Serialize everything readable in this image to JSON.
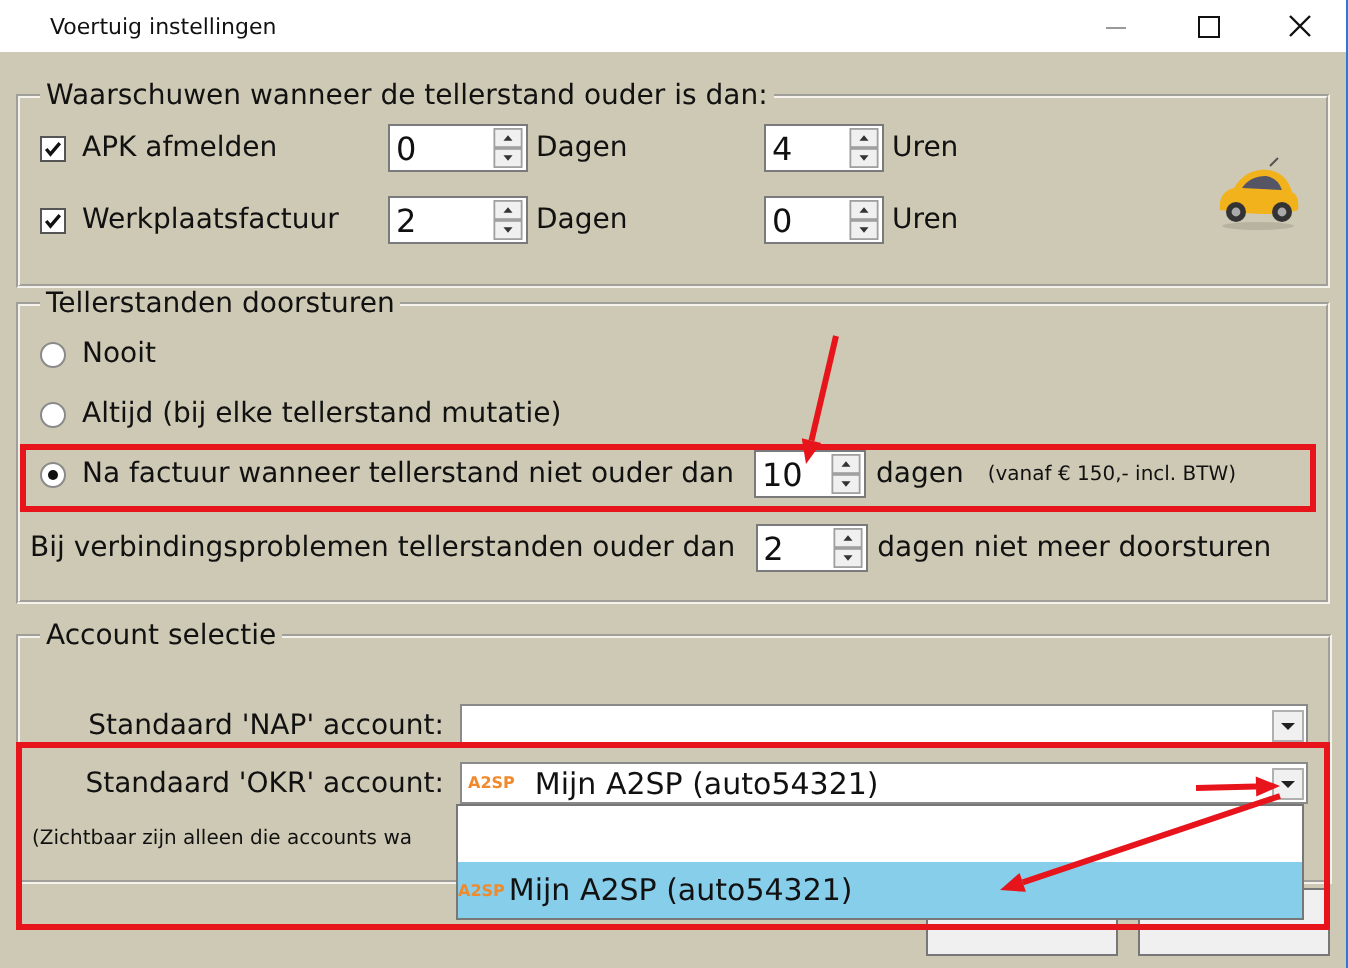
{
  "window": {
    "title": "Voertuig instellingen"
  },
  "warning_group": {
    "title": "Waarschuwen wanneer de tellerstand ouder is dan:",
    "rows": [
      {
        "label": "APK afmelden",
        "checked": true,
        "days": "0",
        "days_unit": "Dagen",
        "hours": "4",
        "hours_unit": "Uren"
      },
      {
        "label": "Werkplaatsfactuur",
        "checked": true,
        "days": "2",
        "days_unit": "Dagen",
        "hours": "0",
        "hours_unit": "Uren"
      }
    ]
  },
  "forward_group": {
    "title": "Tellerstanden doorsturen",
    "options": [
      {
        "label": "Nooit",
        "selected": false
      },
      {
        "label": "Altijd (bij elke tellerstand mutatie)",
        "selected": false
      },
      {
        "label": "Na factuur wanneer tellerstand niet ouder dan",
        "selected": true,
        "value": "10",
        "unit": "dagen",
        "note": "(vanaf € 150,- incl. BTW)"
      }
    ],
    "limit": {
      "label": "Bij verbindingsproblemen tellerstanden ouder dan",
      "value": "2",
      "unit": "dagen niet meer doorsturen"
    }
  },
  "account_group": {
    "title": "Account selectie",
    "fields": [
      {
        "label": "Standaard 'NAP' account:"
      },
      {
        "label": "Standaard 'OKR' account:",
        "logo": "A2SP",
        "value": "Mijn A2SP (auto54321)"
      }
    ],
    "note": "(Zichtbaar zijn alleen die accounts wa",
    "dropdown": {
      "items": [
        {
          "selected": false
        },
        {
          "logo": "A2SP",
          "label": "Mijn A2SP (auto54321)",
          "selected": true
        }
      ]
    }
  },
  "annotations": [
    {
      "kind": "box"
    },
    {
      "kind": "box"
    },
    {
      "kind": "arrow"
    },
    {
      "kind": "arrow"
    },
    {
      "kind": "arrow"
    }
  ]
}
